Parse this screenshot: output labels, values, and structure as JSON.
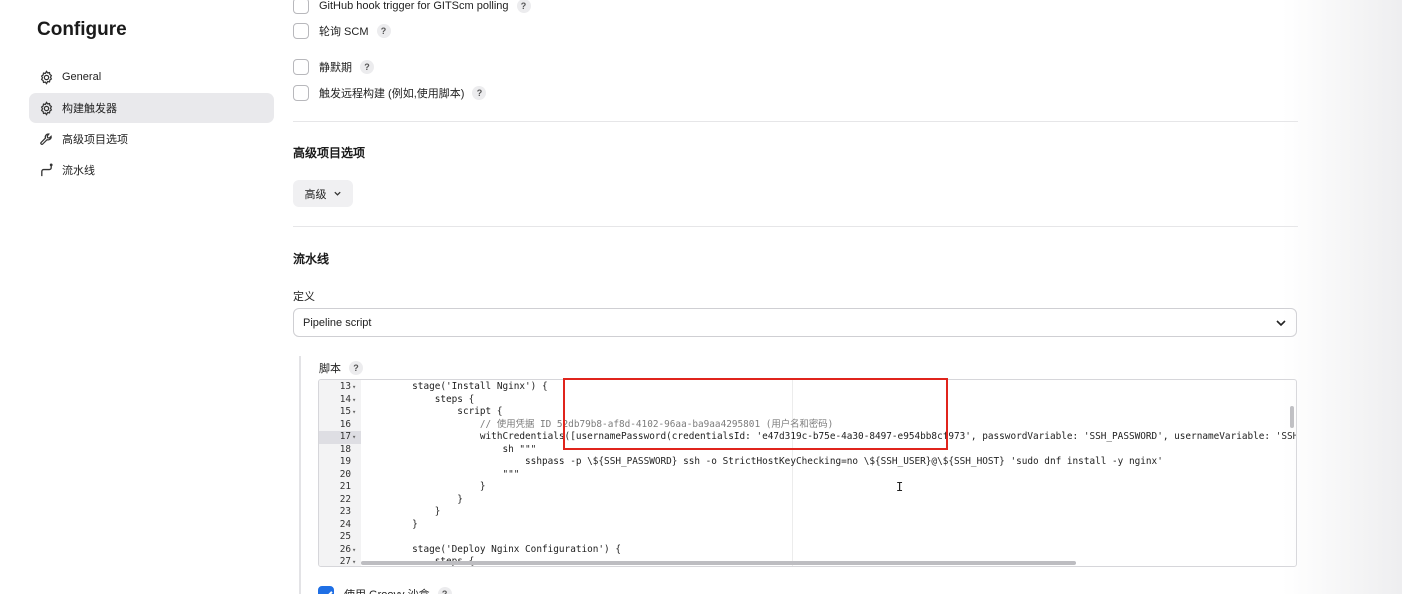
{
  "sidebar": {
    "title": "Configure",
    "items": [
      {
        "label": "General",
        "icon": "gear-icon",
        "active": false
      },
      {
        "label": "构建触发器",
        "icon": "gear-icon",
        "active": true
      },
      {
        "label": "高级项目选项",
        "icon": "wrench-icon",
        "active": false
      },
      {
        "label": "流水线",
        "icon": "pipeline-icon",
        "active": false
      }
    ]
  },
  "triggers": {
    "github_hook": "GitHub hook trigger for GITScm polling",
    "poll_scm": "轮询 SCM",
    "quiet_period": "静默期",
    "remote_build": "触发远程构建 (例如,使用脚本)",
    "help": "?"
  },
  "advanced": {
    "title": "高级项目选项",
    "button": "高级"
  },
  "pipeline": {
    "title": "流水线",
    "definition_label": "定义",
    "definition_value": "Pipeline script",
    "script_label": "脚本",
    "help": "?",
    "groovy_sandbox": "使用 Groovy 沙盒"
  },
  "code_lines": [
    {
      "n": "13",
      "fold": "▾",
      "text": "        stage('Install Nginx') {"
    },
    {
      "n": "14",
      "fold": "▾",
      "text": "            steps {"
    },
    {
      "n": "15",
      "fold": "▾",
      "text": "                script {"
    },
    {
      "n": "16",
      "fold": "",
      "text": "                    // 使用凭据 ID 52db79b8-af8d-4102-96aa-ba9aa4295801 (用户名和密码)"
    },
    {
      "n": "17",
      "fold": "▾",
      "text": "                    withCredentials([usernamePassword(credentialsId: 'e47d319c-b75e-4a30-8497-e954bb8cf973', passwordVariable: 'SSH_PASSWORD', usernameVariable: 'SSH_USER')"
    },
    {
      "n": "18",
      "fold": "",
      "text": "                        sh \"\"\""
    },
    {
      "n": "19",
      "fold": "",
      "text": "                            sshpass -p \\${SSH_PASSWORD} ssh -o StrictHostKeyChecking=no \\${SSH_USER}@\\${SSH_HOST} 'sudo dnf install -y nginx'"
    },
    {
      "n": "20",
      "fold": "",
      "text": "                        \"\"\""
    },
    {
      "n": "21",
      "fold": "",
      "text": "                    }"
    },
    {
      "n": "22",
      "fold": "",
      "text": "                }"
    },
    {
      "n": "23",
      "fold": "",
      "text": "            }"
    },
    {
      "n": "24",
      "fold": "",
      "text": "        }"
    },
    {
      "n": "25",
      "fold": "",
      "text": ""
    },
    {
      "n": "26",
      "fold": "▾",
      "text": "        stage('Deploy Nginx Configuration') {"
    },
    {
      "n": "27",
      "fold": "▾",
      "text": "            steps {"
    }
  ],
  "active_line": "17",
  "colors": {
    "accent": "#1f6fe5",
    "highlight_box": "#e0241c",
    "string": "#1e7a1e",
    "comment": "#7c7c7c"
  }
}
